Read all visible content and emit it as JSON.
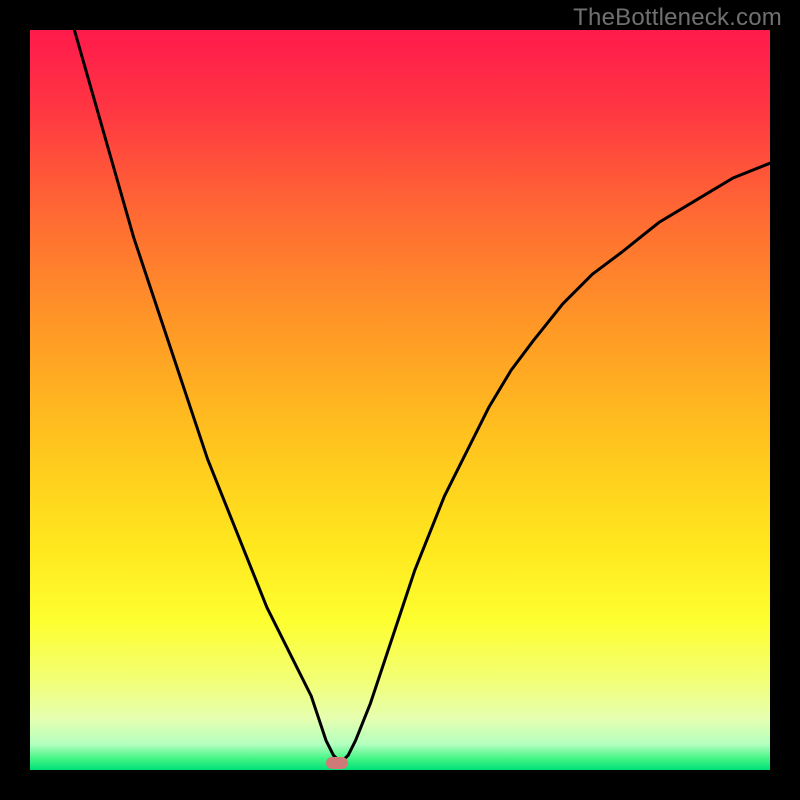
{
  "watermark": "TheBottleneck.com",
  "plot": {
    "size": 740,
    "gradient_stops": [
      {
        "offset": 0.0,
        "color": "#ff1a4c"
      },
      {
        "offset": 0.1,
        "color": "#ff3443"
      },
      {
        "offset": 0.25,
        "color": "#ff6a33"
      },
      {
        "offset": 0.4,
        "color": "#ff9826"
      },
      {
        "offset": 0.55,
        "color": "#ffc21e"
      },
      {
        "offset": 0.7,
        "color": "#ffe81e"
      },
      {
        "offset": 0.8,
        "color": "#fdff30"
      },
      {
        "offset": 0.88,
        "color": "#f2ff77"
      },
      {
        "offset": 0.93,
        "color": "#e6ffb0"
      },
      {
        "offset": 0.965,
        "color": "#b4ffbf"
      },
      {
        "offset": 0.985,
        "color": "#42f585"
      },
      {
        "offset": 1.0,
        "color": "#00e07a"
      }
    ],
    "marker": {
      "x_frac": 0.415,
      "y_frac": 0.991,
      "color": "#cf7a78"
    }
  },
  "chart_data": {
    "type": "line",
    "title": "",
    "xlabel": "",
    "ylabel": "",
    "xlim": [
      0,
      100
    ],
    "ylim": [
      0,
      100
    ],
    "series": [
      {
        "name": "curve",
        "x": [
          6,
          8,
          10,
          12,
          14,
          16,
          18,
          20,
          22,
          24,
          26,
          28,
          30,
          32,
          34,
          36,
          38,
          39,
          40,
          41,
          42,
          43,
          44,
          46,
          48,
          50,
          52,
          54,
          56,
          58,
          60,
          62,
          65,
          68,
          72,
          76,
          80,
          85,
          90,
          95,
          100
        ],
        "y": [
          100,
          93,
          86,
          79,
          72,
          66,
          60,
          54,
          48,
          42,
          37,
          32,
          27,
          22,
          18,
          14,
          10,
          7,
          4,
          2,
          1,
          2,
          4,
          9,
          15,
          21,
          27,
          32,
          37,
          41,
          45,
          49,
          54,
          58,
          63,
          67,
          70,
          74,
          77,
          80,
          82
        ]
      }
    ],
    "annotations": [
      {
        "name": "min-marker",
        "x": 41.5,
        "y": 0.9
      }
    ]
  }
}
